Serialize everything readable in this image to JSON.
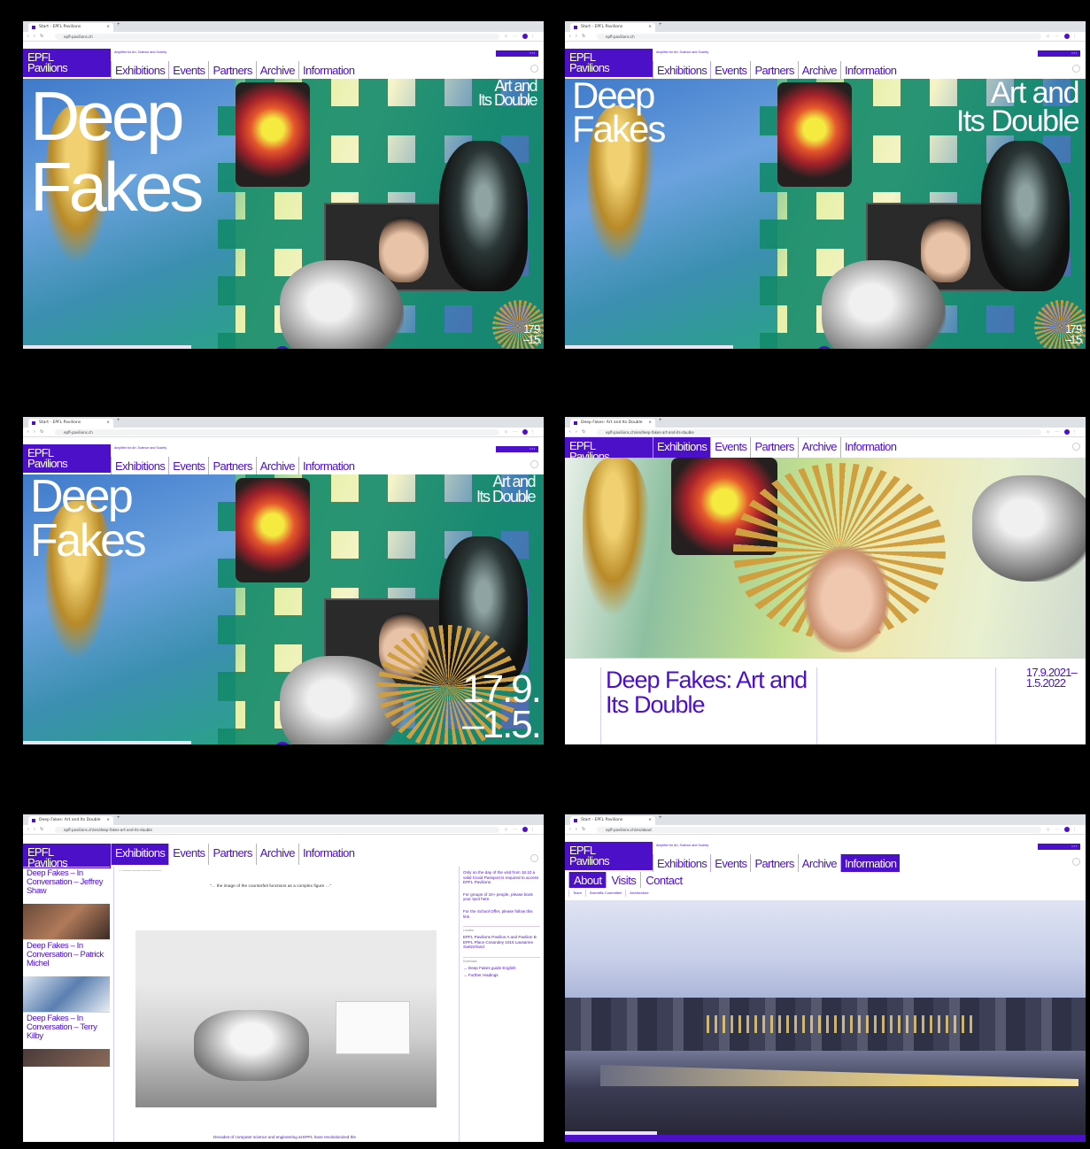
{
  "browser": {
    "tab_title": "Start - EPFL Pavilions",
    "tab_title_exhibition": "Deep Fakes: Art and Its Double",
    "url_home": "epfl-pavilions.ch",
    "url_exhibition": "epfl-pavilions.ch/en/deep-fakes-art-and-its-double",
    "url_information": "epfl-pavilions.ch/en/about"
  },
  "site": {
    "logo_line1": "EPFL",
    "logo_line2": "Pavilions",
    "tagline": "Amplifier for Art, Science and Society",
    "nav": [
      "Exhibitions",
      "Events",
      "Partners",
      "Archive",
      "Information"
    ],
    "accent_color": "#4b10c8"
  },
  "hero": {
    "title_line1": "Deep",
    "title_line2": "Fakes",
    "subtitle_line1": "Art and",
    "subtitle_line2": "Its Double",
    "dates_line1": "17.9.",
    "dates_line2": "–1.5."
  },
  "exhibition": {
    "title": "Deep Fakes: Art and Its Double",
    "dates_line1": "17.9.2021–",
    "dates_line2": "1.5.2022"
  },
  "events": {
    "cards": [
      "Deep Fakes – In Conversation – Jeffrey Shaw",
      "Deep Fakes – In Conversation – Patrick Michel",
      "Deep Fakes – In Conversation – Terry Kilby"
    ],
    "bottom_caption": "Decades of computer science and engineering at EPFL have revolutionized the",
    "sidebar": [
      "Only on the day of the visit from 18.10 a valid Covid Passport is required to access EPFL Pavilions.",
      "For groups of 10+ people, please book your spot here.",
      "For the School Offer, please follow this link."
    ],
    "address_header": "Location",
    "address": "EPFL Pavilions Pavilion A and Pavilion B EPFL Place Cosandey 1015 Lausanne Switzerland",
    "links_header": "Downloads",
    "links": [
      "→ Deep Fakes guide English",
      "→ Further readings"
    ]
  },
  "information": {
    "subnav": [
      "About",
      "Visits",
      "Contact"
    ],
    "tertiary": [
      "Team",
      "Scientific Committee",
      "Architecture"
    ]
  }
}
